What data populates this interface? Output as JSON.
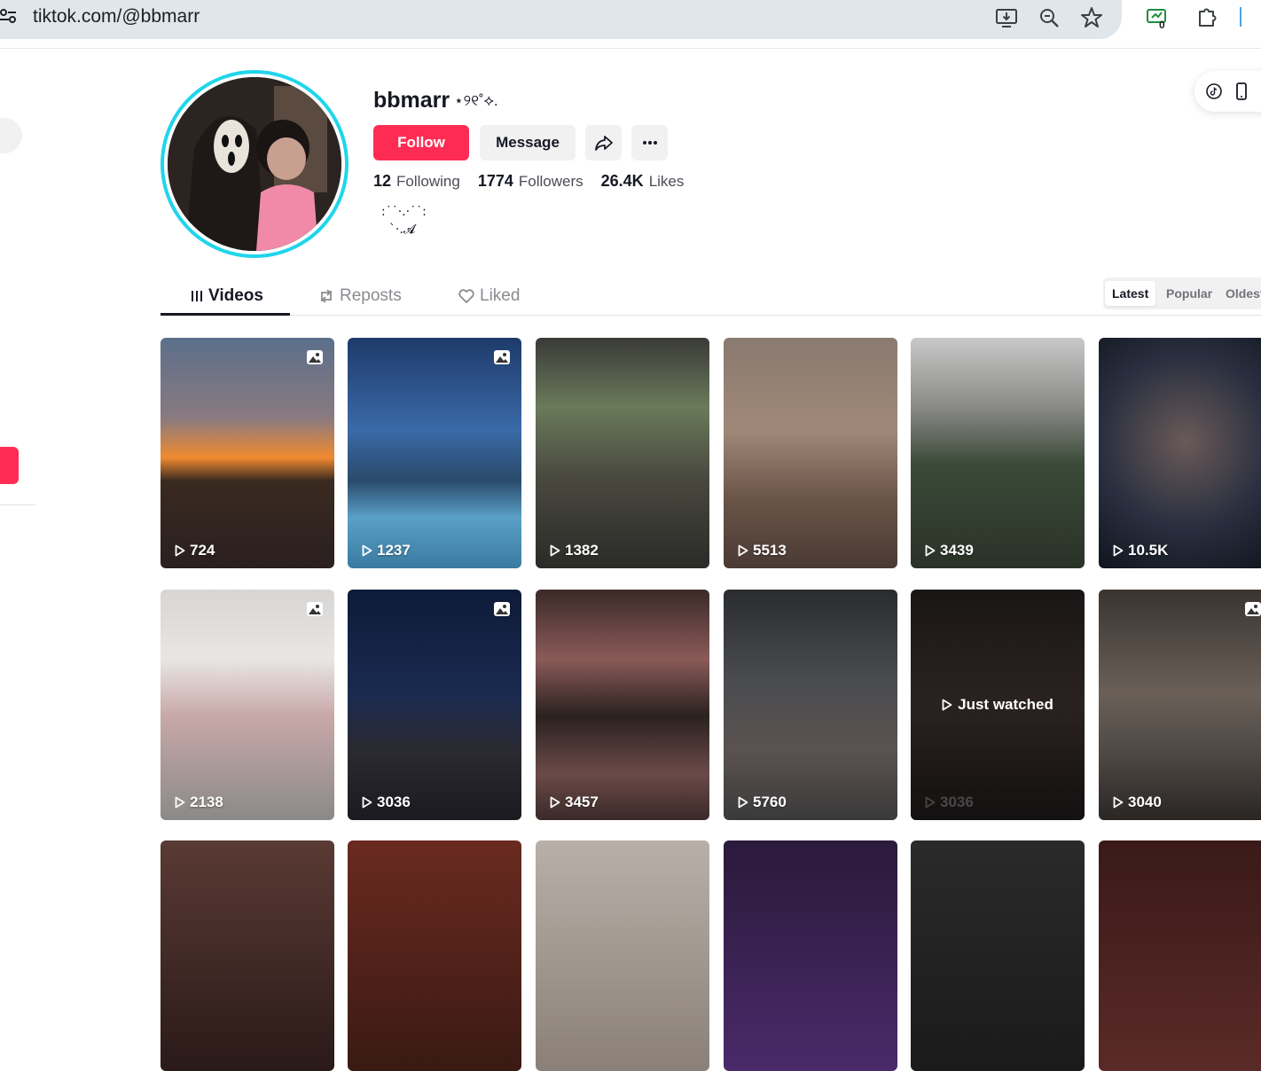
{
  "browser": {
    "url": "tiktok.com/@bbmarr",
    "extension_badge": "0"
  },
  "profile": {
    "username": "bbmarr",
    "nickname": "⋆୨୧˚⟡.",
    "follow_label": "Follow",
    "message_label": "Message",
    "stats": [
      {
        "value": "12",
        "label": "Following"
      },
      {
        "value": "1774",
        "label": "Followers"
      },
      {
        "value": "26.4K",
        "label": "Likes"
      }
    ],
    "bio": ":˙˙·.·˙˙:\n  `·.𝓐"
  },
  "tabs": [
    {
      "label": "Videos",
      "active": true
    },
    {
      "label": "Reposts",
      "active": false
    },
    {
      "label": "Liked",
      "active": false
    }
  ],
  "sort": [
    {
      "label": "Latest",
      "active": true
    },
    {
      "label": "Popular",
      "active": false
    },
    {
      "label": "Oldest",
      "active": false
    }
  ],
  "videos": [
    {
      "views": "724",
      "photo": true,
      "bg": "linear-gradient(180deg,#5b6f8a 0%,#8a7a80 35%,#f08a30 52%,#3a2a20 62%,#2a2020 100%)"
    },
    {
      "views": "1237",
      "photo": true,
      "bg": "linear-gradient(180deg,#1e3a6a 0%,#3a6aa8 40%,#2a4a6a 62%,#5aa0c8 78%,#3a7aa0 100%)"
    },
    {
      "views": "1382",
      "photo": false,
      "bg": "linear-gradient(180deg,#3a3a38 0%,#6a7a5a 30%,#4a4a40 60%,#2a2a28 100%)"
    },
    {
      "views": "5513",
      "photo": false,
      "bg": "linear-gradient(180deg,#8a7a70 0%,#a08878 40%,#6a5448 70%,#4a3a34 100%)"
    },
    {
      "views": "3439",
      "photo": false,
      "bg": "linear-gradient(180deg,#c8c8c8 0%,#8a8a88 30%,#3a4a38 55%,#2a3228 100%)"
    },
    {
      "views": "10.5K",
      "photo": false,
      "bg": "radial-gradient(circle at 50% 45%,#6a5a58 0%,#2a3040 55%,#10141e 100%)"
    },
    {
      "views": "2138",
      "photo": true,
      "bg": "linear-gradient(180deg,#d8d6d4 0%,#e8e6e4 30%,#c8a8a8 55%,#8a8a88 100%)"
    },
    {
      "views": "3036",
      "photo": true,
      "bg": "linear-gradient(180deg,#0e1a38 0%,#1a2a50 45%,#2a2a30 70%,#1a1a20 100%)"
    },
    {
      "views": "3457",
      "photo": false,
      "bg": "linear-gradient(180deg,#3a2a28 0%,#8a5a58 30%,#2a2220 55%,#6a4a48 80%,#3a2a28 100%)"
    },
    {
      "views": "5760",
      "photo": false,
      "bg": "linear-gradient(180deg,#2a2c30 0%,#4a4c50 40%,#5a5250 70%,#3a3a3a 100%)"
    },
    {
      "views": "3036",
      "photo": false,
      "watched": true,
      "bg": "linear-gradient(180deg,#1a1616 0%,#2a2220 50%,#121010 100%)"
    },
    {
      "views": "3040",
      "photo": true,
      "bg": "linear-gradient(180deg,#3a3430 0%,#6a6058 45%,#4a4440 75%,#2a2624 100%)"
    },
    {
      "views": "",
      "photo": false,
      "bg": "linear-gradient(180deg,#5a3a34 0%,#2a1a18 100%)"
    },
    {
      "views": "",
      "photo": false,
      "bg": "linear-gradient(180deg,#6a2a20 0%,#3a1a14 100%)"
    },
    {
      "views": "",
      "photo": false,
      "bg": "linear-gradient(180deg,#b8b0a8 0%,#8a8078 100%)"
    },
    {
      "views": "",
      "photo": false,
      "bg": "linear-gradient(180deg,#2a1a3a 0%,#4a2a6a 100%)"
    },
    {
      "views": "",
      "photo": false,
      "bg": "linear-gradient(180deg,#2a2a2a 0%,#1a1a1a 100%)"
    },
    {
      "views": "",
      "photo": false,
      "bg": "linear-gradient(180deg,#3a1a18 0%,#5a2a28 100%)"
    }
  ],
  "watched_label": "Just watched",
  "colors": {
    "accent": "#fe2c55",
    "avatar_ring": "#20d5ec"
  }
}
